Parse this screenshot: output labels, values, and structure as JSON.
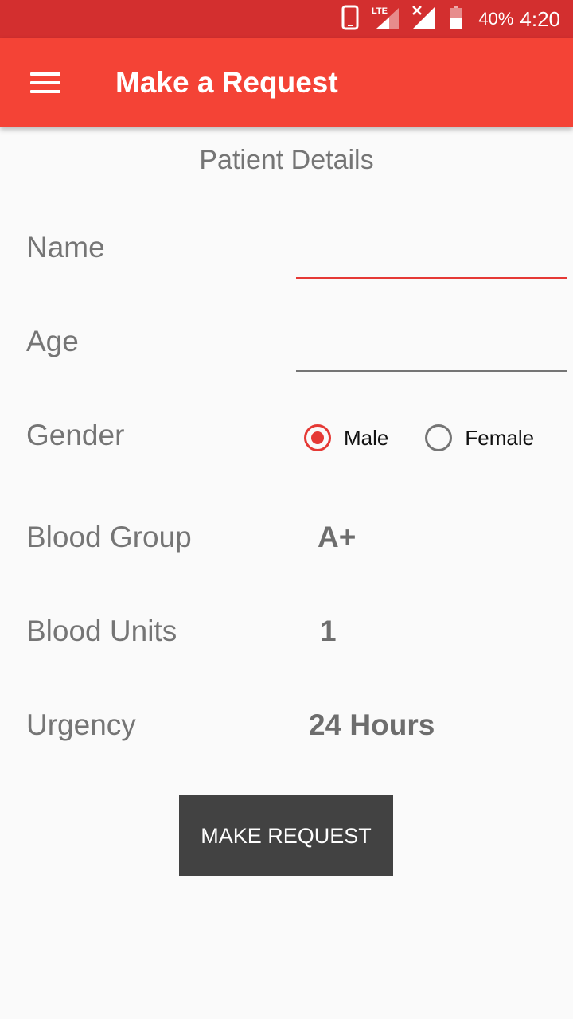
{
  "status_bar": {
    "battery_percent": "40%",
    "time": "4:20",
    "icons": [
      "phone-icon",
      "lte-signal-icon",
      "no-signal-icon",
      "battery-icon"
    ]
  },
  "app_bar": {
    "title": "Make a Request",
    "menu_icon": "hamburger-menu-icon"
  },
  "form": {
    "section_title": "Patient Details",
    "name": {
      "label": "Name",
      "value": "",
      "placeholder": ""
    },
    "age": {
      "label": "Age",
      "value": "",
      "placeholder": ""
    },
    "gender": {
      "label": "Gender",
      "options": [
        "Male",
        "Female"
      ],
      "selected": "Male"
    },
    "blood_group": {
      "label": "Blood Group",
      "value": "A+"
    },
    "blood_units": {
      "label": "Blood Units",
      "value": "1"
    },
    "urgency": {
      "label": "Urgency",
      "value": "24 Hours"
    },
    "submit_label": "MAKE REQUEST"
  },
  "colors": {
    "status_bar": "#d32f2f",
    "app_bar": "#f44336",
    "accent": "#e53935",
    "button": "#424242",
    "background": "#fafafa"
  }
}
